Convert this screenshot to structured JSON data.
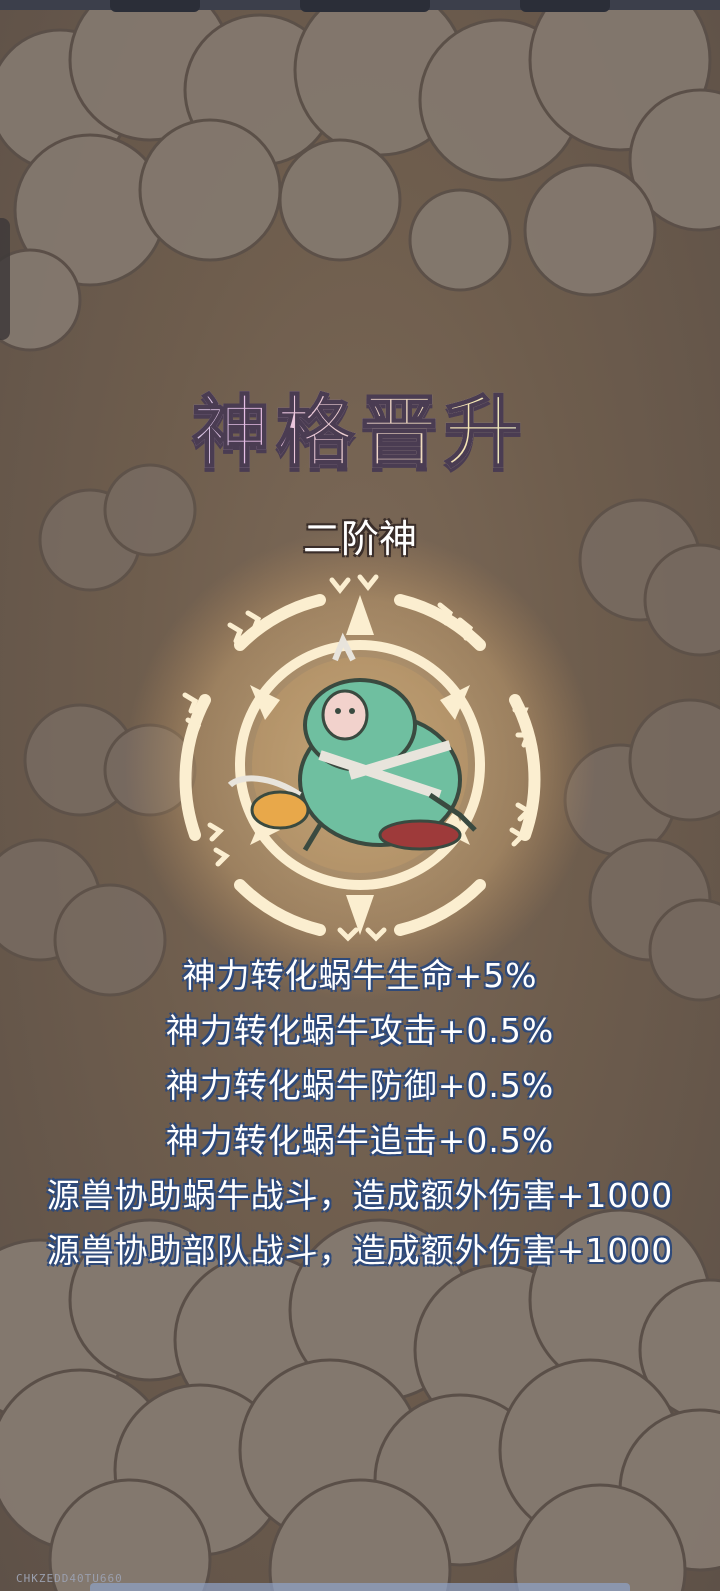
{
  "title": "神格晋升",
  "rank": "二阶神",
  "bonuses": [
    "神力转化蜗牛生命+5%",
    "神力转化蜗牛攻击+0.5%",
    "神力转化蜗牛防御+0.5%",
    "神力转化蜗牛追击+0.5%",
    "源兽协助蜗牛战斗，造成额外伤害+1000",
    "源兽协助部队战斗，造成额外伤害+1000"
  ],
  "watermark": "CHKZEDD40TU660",
  "icons": {
    "emblem": "magic-circle-icon",
    "creature": "zombie-snail-icon"
  },
  "colors": {
    "background": "#6e5d4d",
    "cloud": "#857a70",
    "glow": "#f6d8a0",
    "ring": "#fbeed0",
    "stat_text": "#ffffff",
    "stat_outline": "#2f4a7a"
  }
}
